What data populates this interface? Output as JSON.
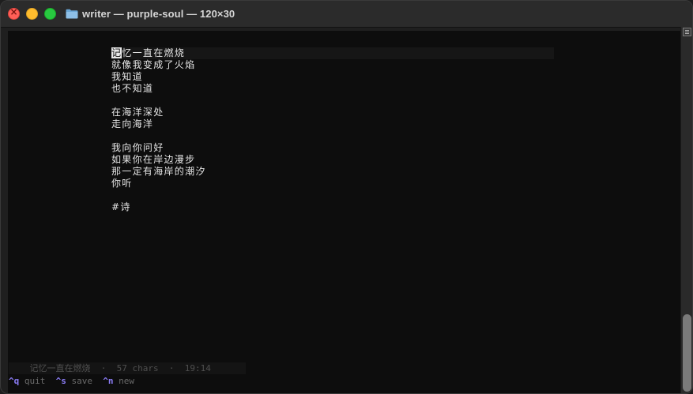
{
  "window": {
    "title": "writer — purple-soul — 120×30"
  },
  "editor": {
    "lines": [
      "记忆一直在燃烧",
      "就像我变成了火焰",
      "我知道",
      "也不知道",
      "",
      "在海洋深处",
      "走向海洋",
      "",
      "我向你问好",
      "如果你在岸边漫步",
      "那一定有海岸的潮汐",
      "你听",
      "",
      "#诗"
    ],
    "cursor_char": "记",
    "first_line_rest": "忆一直在燃烧"
  },
  "status": {
    "title": "记忆一直在燃烧",
    "chars": "57 chars",
    "time": "19:14",
    "separator": "·"
  },
  "keys": [
    {
      "key": "^q",
      "label": "quit"
    },
    {
      "key": "^s",
      "label": "save"
    },
    {
      "key": "^n",
      "label": "new"
    }
  ],
  "colors": {
    "accent": "#8b7cf6",
    "background": "#0d0d0d",
    "text": "#e4e4e4"
  }
}
